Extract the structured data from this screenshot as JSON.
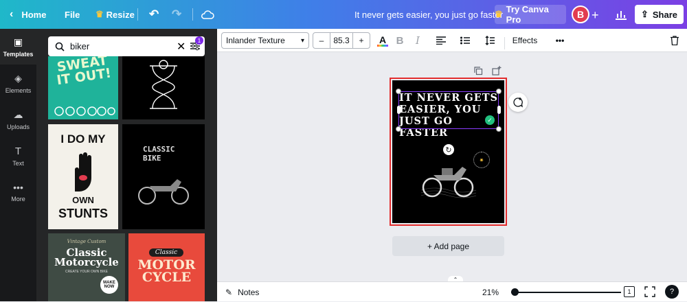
{
  "topbar": {
    "home": "Home",
    "file": "File",
    "resize": "Resize",
    "doc_title": "It never gets easier, you just go faster",
    "try_pro": "Try Canva Pro",
    "avatar_initial": "B",
    "share": "Share"
  },
  "rail": [
    "Templates",
    "Elements",
    "Uploads",
    "Text",
    "More"
  ],
  "search": {
    "value": "biker",
    "badge": "1"
  },
  "templates": [
    {
      "lines": [
        "SWEAT",
        "IT OUT!"
      ],
      "bg": "#1fb39a"
    },
    {
      "lines": [],
      "bg": "#000000"
    },
    {
      "lines": [
        "I DO MY",
        "OWN",
        "STUNTS"
      ],
      "bg": "#f3f1ea"
    },
    {
      "lines": [
        "CLASSIC",
        "BIKE"
      ],
      "bg": "#000000"
    },
    {
      "lines": [
        "Vintage Custom",
        "Classic",
        "Motorcycle",
        "CREATE YOUR OWN BIKE",
        "MAKE",
        "NOW"
      ],
      "bg": "#3f4b44"
    },
    {
      "lines": [
        "Classic",
        "MOTOR",
        "CYCLE"
      ],
      "bg": "#e84a3c"
    }
  ],
  "toolbar": {
    "font": "Inlander Texture",
    "size": "85.3",
    "minus": "–",
    "plus": "+",
    "effects": "Effects"
  },
  "canvas": {
    "headline": "IT NEVER GETS\nEASIER, YOU\nJUST GO FASTER"
  },
  "add_page": "+ Add page",
  "footer": {
    "notes": "Notes",
    "zoom": "21%",
    "page_count": "1"
  },
  "colors": {
    "accent": "#8b3dff",
    "page_border": "#e32c2c",
    "avatar": "#e23c4f"
  }
}
